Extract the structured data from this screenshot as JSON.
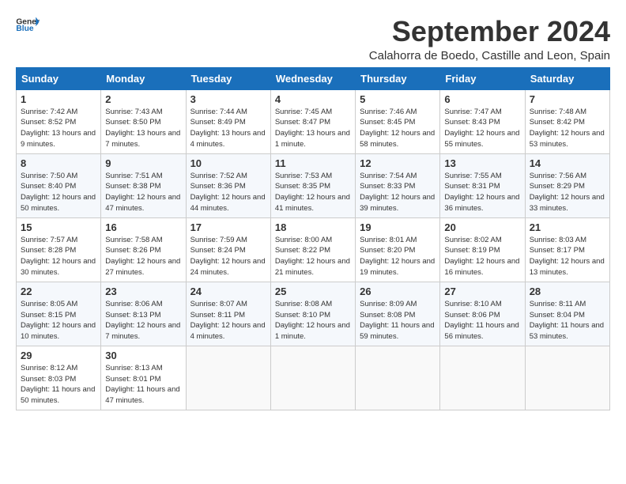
{
  "logo": {
    "general": "General",
    "blue": "Blue"
  },
  "title": "September 2024",
  "location": "Calahorra de Boedo, Castille and Leon, Spain",
  "days_header": [
    "Sunday",
    "Monday",
    "Tuesday",
    "Wednesday",
    "Thursday",
    "Friday",
    "Saturday"
  ],
  "weeks": [
    [
      {
        "day": "1",
        "info": "Sunrise: 7:42 AM\nSunset: 8:52 PM\nDaylight: 13 hours and 9 minutes."
      },
      {
        "day": "2",
        "info": "Sunrise: 7:43 AM\nSunset: 8:50 PM\nDaylight: 13 hours and 7 minutes."
      },
      {
        "day": "3",
        "info": "Sunrise: 7:44 AM\nSunset: 8:49 PM\nDaylight: 13 hours and 4 minutes."
      },
      {
        "day": "4",
        "info": "Sunrise: 7:45 AM\nSunset: 8:47 PM\nDaylight: 13 hours and 1 minute."
      },
      {
        "day": "5",
        "info": "Sunrise: 7:46 AM\nSunset: 8:45 PM\nDaylight: 12 hours and 58 minutes."
      },
      {
        "day": "6",
        "info": "Sunrise: 7:47 AM\nSunset: 8:43 PM\nDaylight: 12 hours and 55 minutes."
      },
      {
        "day": "7",
        "info": "Sunrise: 7:48 AM\nSunset: 8:42 PM\nDaylight: 12 hours and 53 minutes."
      }
    ],
    [
      {
        "day": "8",
        "info": "Sunrise: 7:50 AM\nSunset: 8:40 PM\nDaylight: 12 hours and 50 minutes."
      },
      {
        "day": "9",
        "info": "Sunrise: 7:51 AM\nSunset: 8:38 PM\nDaylight: 12 hours and 47 minutes."
      },
      {
        "day": "10",
        "info": "Sunrise: 7:52 AM\nSunset: 8:36 PM\nDaylight: 12 hours and 44 minutes."
      },
      {
        "day": "11",
        "info": "Sunrise: 7:53 AM\nSunset: 8:35 PM\nDaylight: 12 hours and 41 minutes."
      },
      {
        "day": "12",
        "info": "Sunrise: 7:54 AM\nSunset: 8:33 PM\nDaylight: 12 hours and 39 minutes."
      },
      {
        "day": "13",
        "info": "Sunrise: 7:55 AM\nSunset: 8:31 PM\nDaylight: 12 hours and 36 minutes."
      },
      {
        "day": "14",
        "info": "Sunrise: 7:56 AM\nSunset: 8:29 PM\nDaylight: 12 hours and 33 minutes."
      }
    ],
    [
      {
        "day": "15",
        "info": "Sunrise: 7:57 AM\nSunset: 8:28 PM\nDaylight: 12 hours and 30 minutes."
      },
      {
        "day": "16",
        "info": "Sunrise: 7:58 AM\nSunset: 8:26 PM\nDaylight: 12 hours and 27 minutes."
      },
      {
        "day": "17",
        "info": "Sunrise: 7:59 AM\nSunset: 8:24 PM\nDaylight: 12 hours and 24 minutes."
      },
      {
        "day": "18",
        "info": "Sunrise: 8:00 AM\nSunset: 8:22 PM\nDaylight: 12 hours and 21 minutes."
      },
      {
        "day": "19",
        "info": "Sunrise: 8:01 AM\nSunset: 8:20 PM\nDaylight: 12 hours and 19 minutes."
      },
      {
        "day": "20",
        "info": "Sunrise: 8:02 AM\nSunset: 8:19 PM\nDaylight: 12 hours and 16 minutes."
      },
      {
        "day": "21",
        "info": "Sunrise: 8:03 AM\nSunset: 8:17 PM\nDaylight: 12 hours and 13 minutes."
      }
    ],
    [
      {
        "day": "22",
        "info": "Sunrise: 8:05 AM\nSunset: 8:15 PM\nDaylight: 12 hours and 10 minutes."
      },
      {
        "day": "23",
        "info": "Sunrise: 8:06 AM\nSunset: 8:13 PM\nDaylight: 12 hours and 7 minutes."
      },
      {
        "day": "24",
        "info": "Sunrise: 8:07 AM\nSunset: 8:11 PM\nDaylight: 12 hours and 4 minutes."
      },
      {
        "day": "25",
        "info": "Sunrise: 8:08 AM\nSunset: 8:10 PM\nDaylight: 12 hours and 1 minute."
      },
      {
        "day": "26",
        "info": "Sunrise: 8:09 AM\nSunset: 8:08 PM\nDaylight: 11 hours and 59 minutes."
      },
      {
        "day": "27",
        "info": "Sunrise: 8:10 AM\nSunset: 8:06 PM\nDaylight: 11 hours and 56 minutes."
      },
      {
        "day": "28",
        "info": "Sunrise: 8:11 AM\nSunset: 8:04 PM\nDaylight: 11 hours and 53 minutes."
      }
    ],
    [
      {
        "day": "29",
        "info": "Sunrise: 8:12 AM\nSunset: 8:03 PM\nDaylight: 11 hours and 50 minutes."
      },
      {
        "day": "30",
        "info": "Sunrise: 8:13 AM\nSunset: 8:01 PM\nDaylight: 11 hours and 47 minutes."
      },
      null,
      null,
      null,
      null,
      null
    ]
  ]
}
